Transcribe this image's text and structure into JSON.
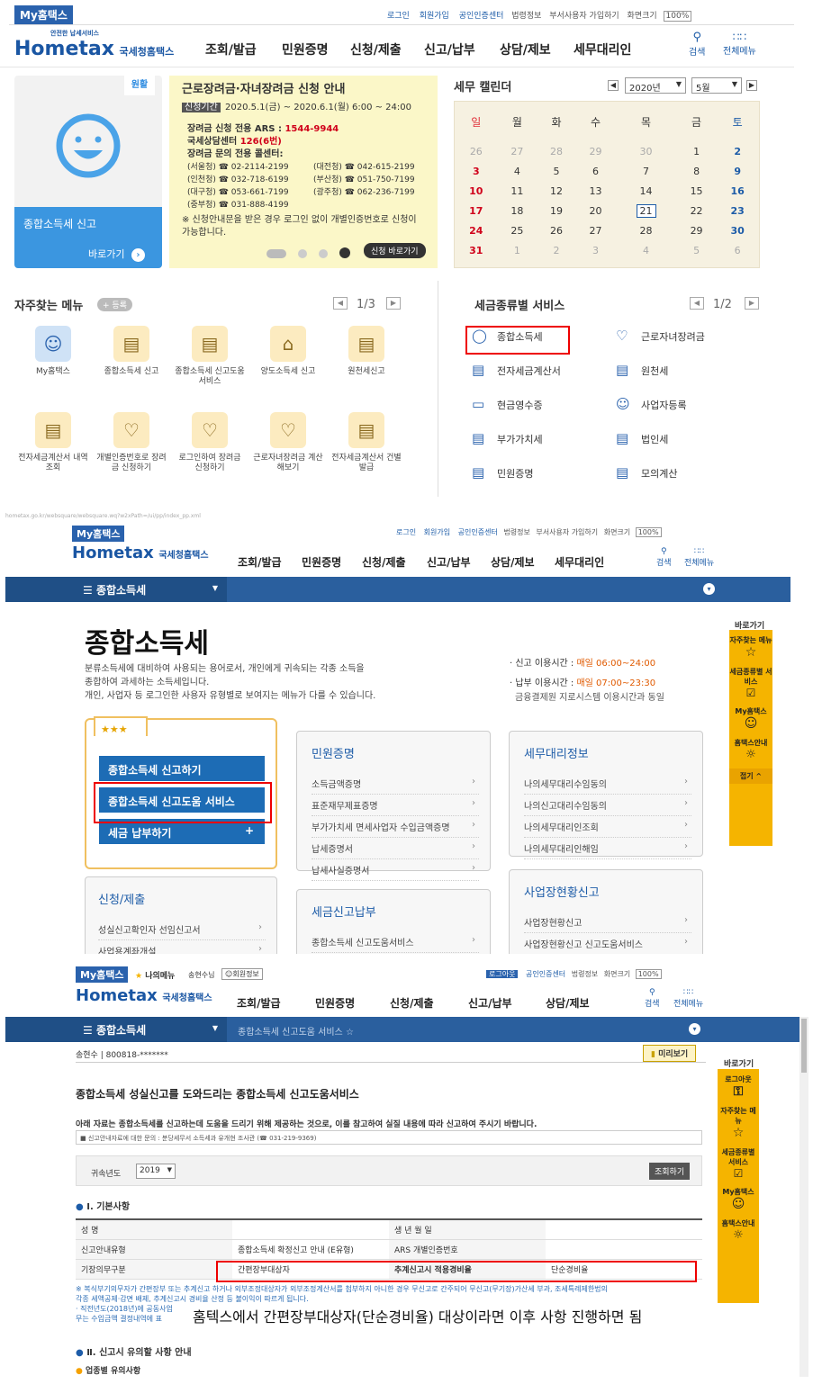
{
  "p1": {
    "mytax": "My홈택스",
    "toplinks": [
      "로그인",
      "회원가입",
      "공인인증센터",
      "법령정보",
      "부서사용자 가입하기",
      "화면크기",
      "100%"
    ],
    "logo_small": "안전한 납세서비스",
    "logo": "Hometax",
    "logo_sub": "국세청홈택스",
    "menu": [
      "조회/발급",
      "민원증명",
      "신청/제출",
      "신고/납부",
      "상담/제보",
      "세무대리인"
    ],
    "search": "검색",
    "allmenu": "전체메뉴",
    "tile": {
      "badge": "원활",
      "title": "종합소득세 신고",
      "go": "바로가기"
    },
    "banner": {
      "title": "근로장려금·자녀장려금 신청 안내",
      "period_label": "신청기간",
      "period": "2020.5.1(금) ~ 2020.6.1(월) 6:00 ~ 24:00",
      "l1": "장려금 신청 전용 ARS : ",
      "l1v": "1544-9944",
      "l2": "국세상담센터 ",
      "l2v": "126(6번)",
      "l3": "장려금 문의 전용 콜센터:",
      "phones": [
        "(서울청) ☎ 02-2114-2199",
        "(대전청) ☎ 042-615-2199",
        "(인천청) ☎ 032-718-6199",
        "(부산청) ☎ 051-750-7199",
        "(대구청) ☎ 053-661-7199",
        "(광주청) ☎ 062-236-7199",
        "(중부청) ☎ 031-888-4199"
      ],
      "note": "※ 신청안내문을 받은 경우 로그인 없이 개별인증번호로 신청이 가능합니다.",
      "apply": "신청 바로가기"
    },
    "cal": {
      "title": "세무 캘린더",
      "year": "2020년",
      "month": "5월",
      "days": [
        "일",
        "월",
        "화",
        "수",
        "목",
        "금",
        "토"
      ],
      "rows": [
        [
          "26",
          "27",
          "28",
          "29",
          "30",
          "1",
          "2"
        ],
        [
          "3",
          "4",
          "5",
          "6",
          "7",
          "8",
          "9"
        ],
        [
          "10",
          "11",
          "12",
          "13",
          "14",
          "15",
          "16"
        ],
        [
          "17",
          "18",
          "19",
          "20",
          "21",
          "22",
          "23"
        ],
        [
          "24",
          "25",
          "26",
          "27",
          "28",
          "29",
          "30"
        ],
        [
          "31",
          "1",
          "2",
          "3",
          "4",
          "5",
          "6"
        ]
      ]
    },
    "freq": {
      "title": "자주찾는 메뉴",
      "add": "+ 등록",
      "page": "1/3",
      "items": [
        "My홈택스",
        "종합소득세 신고",
        "종합소득세 신고도움 서비스",
        "양도소득세 신고",
        "원천세신고",
        "전자세금계산서 내역조회",
        "개별인증번호로 장려금 신청하기",
        "로그인하여 장려금 신청하기",
        "근로자녀장려금 계산해보기",
        "전자세금계산서 건별발급"
      ]
    },
    "tax": {
      "title": "세금종류별 서비스",
      "page": "1/2",
      "items": [
        "종합소득세",
        "근로자녀장려금",
        "전자세금계산서",
        "원천세",
        "현금영수증",
        "사업자등록",
        "부가가치세",
        "법인세",
        "민원증명",
        "모의계산"
      ]
    }
  },
  "p2": {
    "url": "hometax.go.kr/websquare/websquare.wq?w2xPath=/ui/pp/index_pp.xml",
    "nav": "종합소득세",
    "title": "종합소득세",
    "desc": [
      "분류소득세에 대비하여 사용되는 용어로서, 개인에게 귀속되는 각종 소득을",
      "종합하여 과세하는 소득세입니다.",
      "개인, 사업자 등 로그인한 사용자 유형별로 보여지는 메뉴가 다를 수 있습니다."
    ],
    "time1_label": "· 신고 이용시간 : ",
    "time1": "매일 06:00~24:00",
    "time2_label": "· 납부 이용시간 : ",
    "time2": "매일 07:00~23:30",
    "time2_note": "금융결제원 지로시스템 이용시간과 동일",
    "stars": "★★★",
    "btns": [
      "종합소득세 신고하기",
      "종합소득세 신고도움 서비스",
      "세금 납부하기"
    ],
    "plus": "+",
    "civil": {
      "title": "민원증명",
      "items": [
        "소득금액증명",
        "표준재무제표증명",
        "부가가치세 면세사업자 수입금액증명",
        "납세증명서",
        "납세사실증명서"
      ]
    },
    "agent": {
      "title": "세무대리정보",
      "items": [
        "나의세무대리수임동의",
        "나의신고대리수임동의",
        "나의세무대리인조회",
        "나의세무대리인해임"
      ]
    },
    "apply": {
      "title": "신청/제출",
      "items": [
        "성실신고확인자 선임신고서",
        "사업용계좌개설"
      ]
    },
    "pay": {
      "title": "세금신고납부",
      "items": [
        "종합소득세 신고도움서비스"
      ]
    },
    "biz": {
      "title": "사업장현황신고",
      "items": [
        "사업장현황신고",
        "사업장현황신고 신고도움서비스"
      ]
    },
    "side": {
      "title": "바로가기",
      "items": [
        "자주찾는 메뉴",
        "세금종류별 서비스",
        "My홈택스",
        "홈택스안내"
      ],
      "fold": "접기 ^"
    }
  },
  "p3": {
    "mymenu": "나의메뉴",
    "user": "송현수님",
    "userinfo": "회원정보",
    "logout": "로그아웃",
    "crumb": "종합소득세 신고도움 서비스",
    "name": "송현수",
    "rrn": "800818-*******",
    "preview": "미리보기",
    "heading": "종합소득세 성실신고를 도와드리는 종합소득세 신고도움서비스",
    "notice": "아래 자료는 종합소득세를 신고하는데 도움을 드리기 위해 제공하는 것으로, 이를 참고하여 실질 내용에 따라 신고하여 주시기 바랍니다.",
    "contact": "■ 신고안내자료에 대한 문의 : 분당세무서 소득세과 유개현 조사관 (☎ 031-219-9369)",
    "year_label": "귀속년도",
    "year": "2019",
    "query": "조회하기",
    "sec1": "Ⅰ. 기본사항",
    "rows": [
      [
        "성          명",
        "",
        "생  년  월  일",
        ""
      ],
      [
        "신고안내유형",
        "종합소득세 확정신고 안내 (E유형)",
        "ARS 개별인증번호",
        ""
      ],
      [
        "기장의무구분",
        "간편장부대상자",
        "추계신고시 적용경비율",
        "단순경비율"
      ]
    ],
    "foot1": "※ 복식부기의무자가 간편장부 또는 추계신고 하거나 외부조정대상자가 외부조정계산서를 첨부하지 아니한 경우 무신고로 간주되어 무신고(무기장)가산세 부과, 조세특례제한법의",
    "foot2": "각종 세액공제·감면 배제, 추계신고시 경비율 산정 등 불이익이 따르게 됩니다.",
    "foot3": "· 직전년도(2018년)에 공동사업",
    "foot4": "무는 수입금액 결정내역에 표",
    "caption": "홈텍스에서 간편장부대상자(단순경비율) 대상이라면 이후 사항 진행하면 됨",
    "sec2": "Ⅱ. 신고시 유의할 사항 안내",
    "sub": "업종별 유의사항",
    "side": {
      "title": "바로가기",
      "items": [
        "로그아웃",
        "자주찾는 메뉴",
        "세금종류별 서비스",
        "My홈택스",
        "홈택스안내"
      ]
    }
  }
}
